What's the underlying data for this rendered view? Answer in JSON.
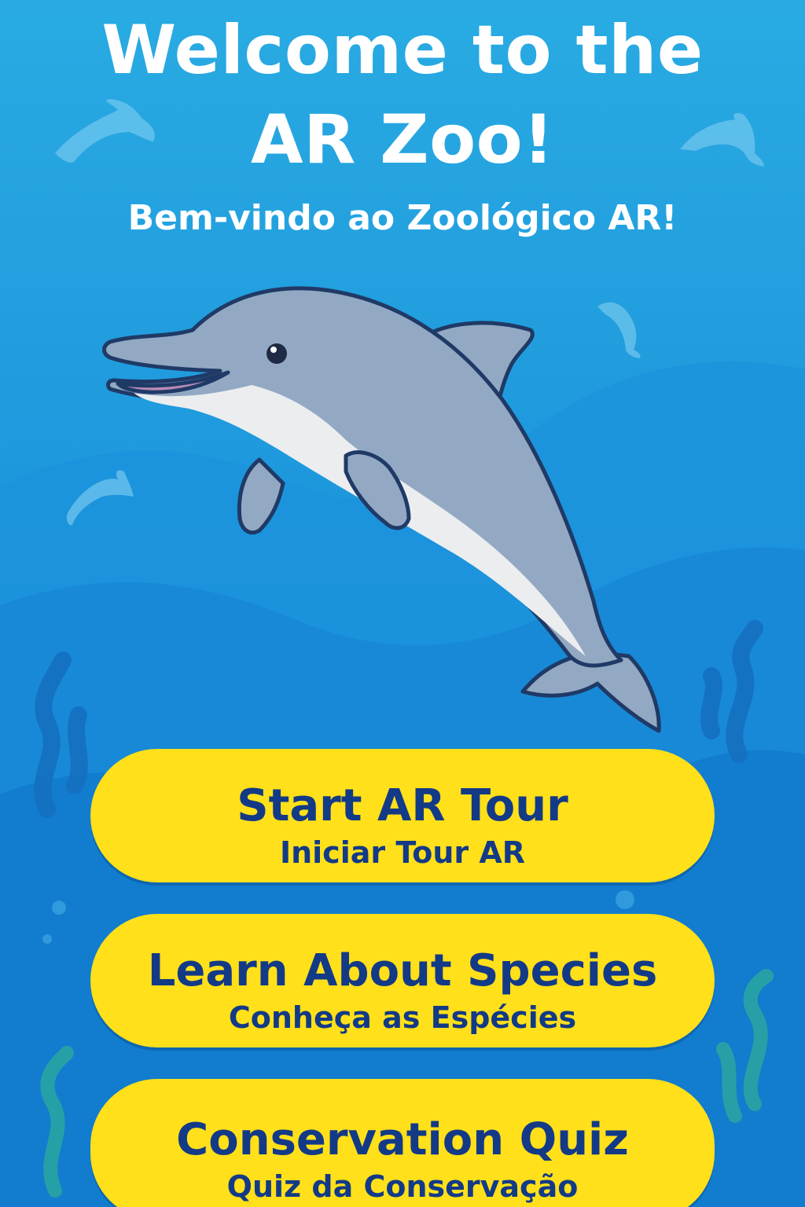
{
  "header": {
    "title_line1": "Welcome to the",
    "title_line2": "AR Zoo!",
    "subtitle": "Bem-vindo ao Zoológico AR!"
  },
  "hero": {
    "image": "dolphin-illustration",
    "background_icons": [
      "dolphin-silhouette-icon",
      "seaweed-icon",
      "bubble-icon"
    ]
  },
  "menu": {
    "buttons": [
      {
        "label": "Start AR Tour",
        "sublabel": "Iniciar Tour AR"
      },
      {
        "label": "Learn About Species",
        "sublabel": "Conheça as Espécies"
      },
      {
        "label": "Conservation Quiz",
        "sublabel": "Quiz da Conservação"
      }
    ]
  },
  "colors": {
    "background_top": "#29ABE2",
    "background_bottom": "#0F72C6",
    "button_fill": "#FFE01A",
    "button_text": "#133A86",
    "title_text": "#FFFFFF",
    "dolphin_body": "#93A9C3",
    "dolphin_belly": "#ECEDEF",
    "dolphin_outline": "#1F3A66"
  }
}
